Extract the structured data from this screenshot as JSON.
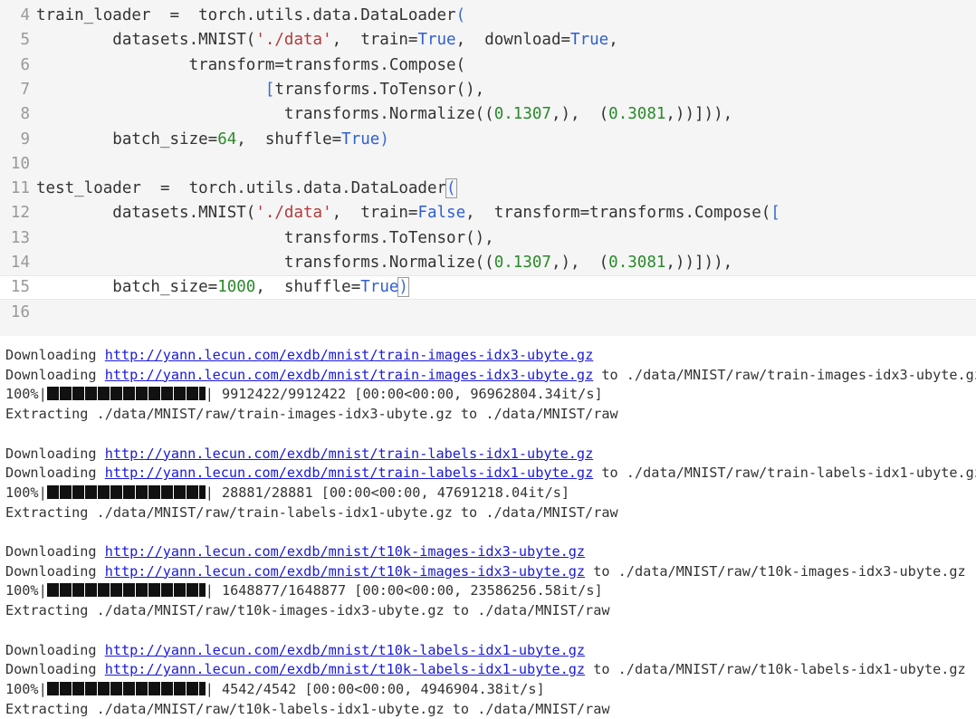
{
  "code_cell": {
    "lines": [
      {
        "num": "4",
        "tokens": [
          [
            "p",
            "train_loader  =  torch.utils.data.DataLoader"
          ],
          [
            "br",
            "("
          ]
        ]
      },
      {
        "num": "5",
        "tokens": [
          [
            "p",
            "        datasets.MNIST("
          ],
          [
            "str",
            "'./data'"
          ],
          [
            "p",
            ",  train="
          ],
          [
            "kw",
            "True"
          ],
          [
            "p",
            ",  download="
          ],
          [
            "kw",
            "True"
          ],
          [
            "p",
            ","
          ]
        ]
      },
      {
        "num": "6",
        "tokens": [
          [
            "p",
            "                transform=transforms.Compose("
          ]
        ]
      },
      {
        "num": "7",
        "tokens": [
          [
            "p",
            "                        "
          ],
          [
            "br",
            "["
          ],
          [
            "p",
            "transforms.ToTensor(),"
          ]
        ]
      },
      {
        "num": "8",
        "tokens": [
          [
            "p",
            "                          transforms.Normalize(("
          ],
          [
            "num",
            "0.1307"
          ],
          [
            "p",
            ",),  ("
          ],
          [
            "num",
            "0.3081"
          ],
          [
            "p",
            ",))])),"
          ]
        ]
      },
      {
        "num": "9",
        "tokens": [
          [
            "p",
            "        batch_size="
          ],
          [
            "num",
            "64"
          ],
          [
            "p",
            ",  shuffle="
          ],
          [
            "kw",
            "True"
          ],
          [
            "br",
            ")"
          ]
        ]
      },
      {
        "num": "10",
        "tokens": [
          [
            "p",
            ""
          ]
        ]
      },
      {
        "num": "11",
        "tokens": [
          [
            "p",
            "test_loader  =  torch.utils.data.DataLoader"
          ],
          [
            "brc",
            "("
          ]
        ]
      },
      {
        "num": "12",
        "tokens": [
          [
            "p",
            "        datasets.MNIST("
          ],
          [
            "str",
            "'./data'"
          ],
          [
            "p",
            ",  train="
          ],
          [
            "kw",
            "False"
          ],
          [
            "p",
            ",  transform=transforms.Compose("
          ],
          [
            "br",
            "["
          ]
        ]
      },
      {
        "num": "13",
        "tokens": [
          [
            "p",
            "                          transforms.ToTensor(),"
          ]
        ]
      },
      {
        "num": "14",
        "tokens": [
          [
            "p",
            "                          transforms.Normalize(("
          ],
          [
            "num",
            "0.1307"
          ],
          [
            "p",
            ",),  ("
          ],
          [
            "num",
            "0.3081"
          ],
          [
            "p",
            ",))])),"
          ]
        ]
      },
      {
        "num": "15",
        "tokens": [
          [
            "p",
            "        batch_size="
          ],
          [
            "num",
            "1000"
          ],
          [
            "p",
            ",  shuffle="
          ],
          [
            "kw",
            "True"
          ],
          [
            "brc",
            ")"
          ]
        ]
      },
      {
        "num": "16",
        "tokens": [
          [
            "p",
            ""
          ]
        ]
      }
    ],
    "current_line_index": 11
  },
  "output": {
    "blocks": [
      {
        "download_label": "Downloading ",
        "url": "http://yann.lecun.com/exdb/mnist/train-images-idx3-ubyte.gz",
        "to_suffix": " to ./data/MNIST/raw/train-images-idx3-ubyte.gz",
        "percent": "100%|",
        "progress_fraction": 1.0,
        "progress_stats": "| 9912422/9912422 [00:00<00:00, 96962804.34it/s]",
        "extract": "Extracting ./data/MNIST/raw/train-images-idx3-ubyte.gz to ./data/MNIST/raw"
      },
      {
        "download_label": "Downloading ",
        "url": "http://yann.lecun.com/exdb/mnist/train-labels-idx1-ubyte.gz",
        "to_suffix": " to ./data/MNIST/raw/train-labels-idx1-ubyte.gz",
        "percent": "100%|",
        "progress_fraction": 1.0,
        "progress_stats": "| 28881/28881 [00:00<00:00, 47691218.04it/s]",
        "extract": "Extracting ./data/MNIST/raw/train-labels-idx1-ubyte.gz to ./data/MNIST/raw"
      },
      {
        "download_label": "Downloading ",
        "url": "http://yann.lecun.com/exdb/mnist/t10k-images-idx3-ubyte.gz",
        "to_suffix": " to ./data/MNIST/raw/t10k-images-idx3-ubyte.gz",
        "percent": "100%|",
        "progress_fraction": 1.0,
        "progress_stats": "| 1648877/1648877 [00:00<00:00, 23586256.58it/s]",
        "extract": "Extracting ./data/MNIST/raw/t10k-images-idx3-ubyte.gz to ./data/MNIST/raw"
      },
      {
        "download_label": "Downloading ",
        "url": "http://yann.lecun.com/exdb/mnist/t10k-labels-idx1-ubyte.gz",
        "to_suffix": " to ./data/MNIST/raw/t10k-labels-idx1-ubyte.gz",
        "percent": "100%|",
        "progress_fraction": 1.0,
        "progress_stats": "| 4542/4542 [00:00<00:00, 4946904.38it/s]",
        "extract": "Extracting ./data/MNIST/raw/t10k-labels-idx1-ubyte.gz to ./data/MNIST/raw"
      }
    ]
  }
}
